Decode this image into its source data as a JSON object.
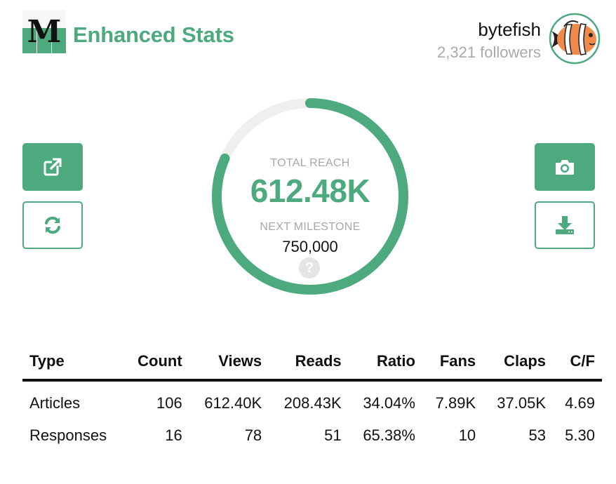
{
  "header": {
    "logo_letter": "M",
    "title": "Enhanced Stats",
    "user_name": "bytefish",
    "followers": "2,321 followers"
  },
  "colors": {
    "accent": "#4caa7e",
    "track": "#efefef",
    "muted": "#a8a8a8"
  },
  "actions": {
    "left": [
      {
        "icon": "external-link-icon",
        "style": "solid"
      },
      {
        "icon": "refresh-icon",
        "style": "outline"
      }
    ],
    "right": [
      {
        "icon": "camera-icon",
        "style": "solid"
      },
      {
        "icon": "download-icon",
        "style": "outline"
      }
    ]
  },
  "gauge": {
    "label": "TOTAL REACH",
    "value": "612.48K",
    "milestone_label": "NEXT MILESTONE",
    "milestone_value": "750,000",
    "progress_fraction": 0.8166,
    "help_icon": "question-icon"
  },
  "table": {
    "headers": [
      "Type",
      "Count",
      "Views",
      "Reads",
      "Ratio",
      "Fans",
      "Claps",
      "C/F"
    ],
    "rows": [
      [
        "Articles",
        "106",
        "612.40K",
        "208.43K",
        "34.04%",
        "7.89K",
        "37.05K",
        "4.69"
      ],
      [
        "Responses",
        "16",
        "78",
        "51",
        "65.38%",
        "10",
        "53",
        "5.30"
      ]
    ]
  }
}
